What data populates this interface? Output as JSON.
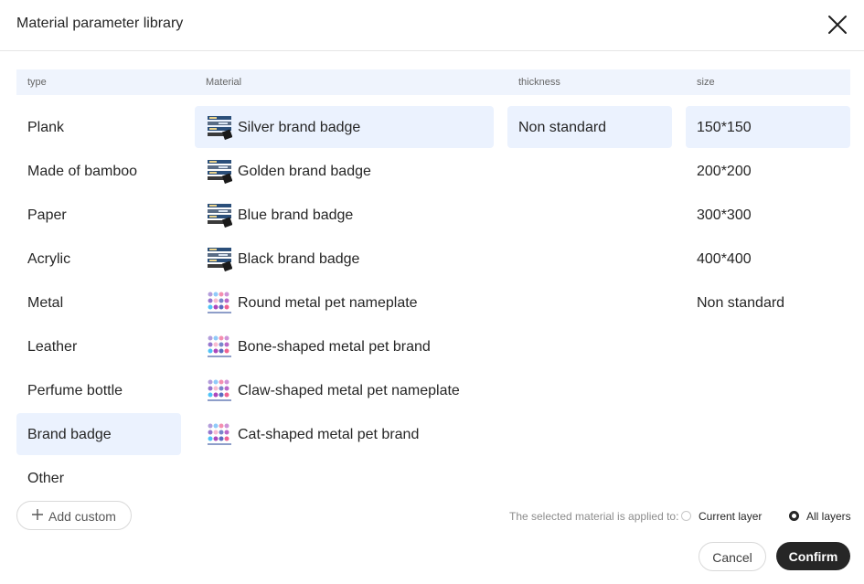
{
  "dialog": {
    "title": "Material parameter library"
  },
  "columns": {
    "type": "type",
    "material": "Material",
    "thickness": "thickness",
    "size": "size"
  },
  "types": [
    "Plank",
    "Made of bamboo",
    "Paper",
    "Acrylic",
    "Metal",
    "Leather",
    "Perfume bottle",
    "Brand badge",
    "Other"
  ],
  "selected_type": "Brand badge",
  "materials": [
    {
      "label": "Silver brand badge",
      "icon": "badge-sample-icon"
    },
    {
      "label": "Golden brand badge",
      "icon": "badge-sample-icon"
    },
    {
      "label": "Blue brand badge",
      "icon": "badge-sample-icon"
    },
    {
      "label": "Black brand badge",
      "icon": "badge-sample-icon"
    },
    {
      "label": "Round metal pet nameplate",
      "icon": "pet-tag-sample-icon"
    },
    {
      "label": "Bone-shaped metal pet brand",
      "icon": "pet-tag-sample-icon"
    },
    {
      "label": "Claw-shaped metal pet nameplate",
      "icon": "pet-tag-sample-icon"
    },
    {
      "label": "Cat-shaped metal pet brand",
      "icon": "pet-tag-sample-icon"
    }
  ],
  "selected_material": "Silver brand badge",
  "thickness": [
    "Non standard"
  ],
  "selected_thickness": "Non standard",
  "sizes": [
    "150*150",
    "200*200",
    "300*300",
    "400*400",
    "Non standard"
  ],
  "selected_size": "150*150",
  "footer": {
    "add_custom": "Add custom",
    "apply_label": "The selected material is applied to:",
    "options": [
      "Current layer",
      "All layers"
    ],
    "selected_option": "All layers",
    "cancel": "Cancel",
    "confirm": "Confirm"
  },
  "colors": {
    "accent": "#262626",
    "selected_bg": "#ebf2fe",
    "header_bg": "#eff4fd"
  }
}
